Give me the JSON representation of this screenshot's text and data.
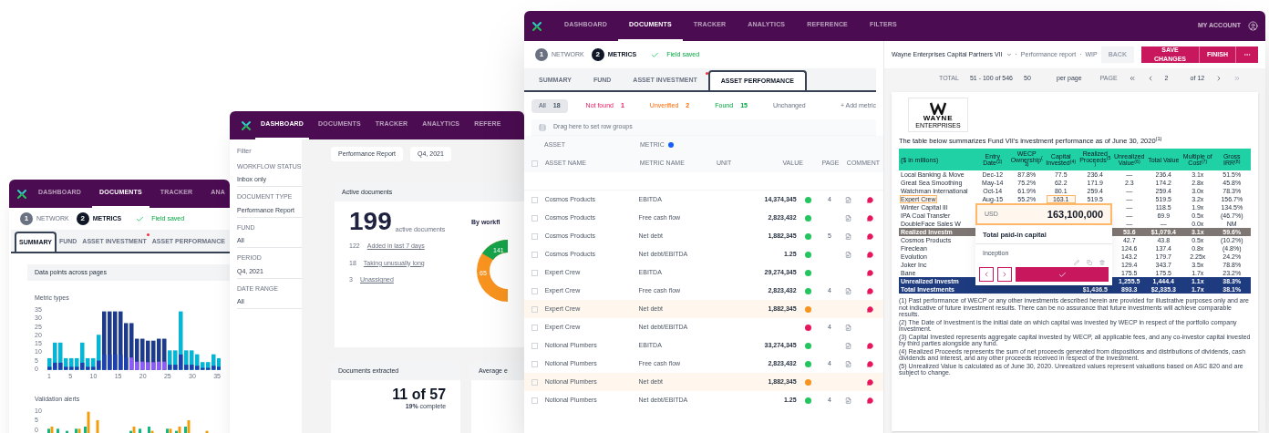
{
  "back_window": {
    "nav": [
      {
        "label": "DASHBOARD",
        "selected": false
      },
      {
        "label": "DOCUMENTS",
        "selected": true
      },
      {
        "label": "TRACKER",
        "selected": false
      },
      {
        "label": "ANA",
        "selected": false
      }
    ],
    "steps": [
      {
        "number": "1",
        "label": "NETWORK",
        "selected": false
      },
      {
        "number": "2",
        "label": "METRICS",
        "selected": true
      }
    ],
    "save_status": "Field saved",
    "tabs": [
      {
        "label": "SUMMARY",
        "selected": true,
        "alert": false
      },
      {
        "label": "FUND",
        "selected": false,
        "alert": false
      },
      {
        "label": "ASSET INVESTMENT",
        "selected": false,
        "alert": true
      },
      {
        "label": "ASSET PERFORMANCE",
        "selected": false,
        "alert": false
      }
    ],
    "card_title": "Data points across pages",
    "charts": [
      {
        "title": "Metric types",
        "y_ticks": [
          "35",
          "30",
          "25",
          "20",
          "15",
          "10",
          "5",
          "0"
        ],
        "x_ticks": [
          "1",
          "5",
          "10",
          "15",
          "20",
          "25",
          "30",
          "35"
        ]
      },
      {
        "title": "Validation alerts",
        "y_ticks": [
          "10",
          "5",
          "0"
        ]
      }
    ]
  },
  "middle_window": {
    "nav": [
      {
        "label": "DASHBOARD",
        "selected": true
      },
      {
        "label": "DOCUMENTS",
        "selected": false
      },
      {
        "label": "TRACKER",
        "selected": false
      },
      {
        "label": "ANALYTICS",
        "selected": false
      },
      {
        "label": "REFERE",
        "selected": false
      }
    ],
    "filters_title": "Filter",
    "filters": [
      {
        "label": "WORKFLOW STATUS",
        "value": "Inbox only"
      },
      {
        "label": "DOCUMENT TYPE",
        "value": "Performance Report"
      },
      {
        "label": "FUND",
        "value": "All"
      },
      {
        "label": "PERIOD",
        "value": "Q4, 2021"
      },
      {
        "label": "DATE RANGE",
        "value": "All"
      }
    ],
    "chips": [
      "Performance Report",
      "Q4, 2021"
    ],
    "active_card": {
      "title": "Active documents",
      "count": "199",
      "count_label": "active documents",
      "items": [
        {
          "count": "122",
          "label": "Added in last 7 days"
        },
        {
          "count": "18",
          "label": "Taking unusually long"
        },
        {
          "count": "3",
          "label": "Unassigned"
        }
      ],
      "side_title": "By workfl",
      "donut_labels": [
        "141",
        "65"
      ]
    },
    "extracted_card": {
      "title": "Documents extracted",
      "value": "11 of 57",
      "note": "**19%** complete"
    },
    "average_card": {
      "title": "Average e"
    }
  },
  "front_window": {
    "nav": [
      {
        "label": "DASHBOARD",
        "selected": false
      },
      {
        "label": "DOCUMENTS",
        "selected": true
      },
      {
        "label": "TRACKER",
        "selected": false
      },
      {
        "label": "ANALYTICS",
        "selected": false
      },
      {
        "label": "REFERENCE",
        "selected": false
      },
      {
        "label": "FILTERS",
        "selected": false
      }
    ],
    "account": "MY ACCOUNT",
    "steps": [
      {
        "number": "1",
        "label": "NETWORK",
        "selected": false
      },
      {
        "number": "2",
        "label": "METRICS",
        "selected": true
      }
    ],
    "save_status": "Field saved",
    "tabs": [
      {
        "label": "SUMMARY",
        "selected": false,
        "alert": false
      },
      {
        "label": "FUND",
        "selected": false,
        "alert": false
      },
      {
        "label": "ASSET INVESTMENT",
        "selected": false,
        "alert": true
      },
      {
        "label": "ASSET PERFORMANCE",
        "selected": true,
        "alert": false
      }
    ],
    "filter_chips": [
      {
        "kind": "all",
        "label": "All",
        "count": "18",
        "selected": true
      },
      {
        "kind": "not_found",
        "label": "Not found",
        "count": "1",
        "selected": false
      },
      {
        "kind": "unverified",
        "label": "Unverified",
        "count": "2",
        "selected": false
      },
      {
        "kind": "found",
        "label": "Found",
        "count": "15",
        "selected": false
      },
      {
        "kind": "unchanged",
        "label": "Unchanged",
        "selected": false
      }
    ],
    "add_button": "+ Add metric",
    "group_hint": "Drag here to set row groups",
    "group_columns": [
      {
        "label": "ASSET",
        "badge": false
      },
      {
        "label": "METRIC",
        "badge": true
      }
    ],
    "select_all_checked": false,
    "columns": [
      "ASSET NAME",
      "METRIC NAME",
      "UNIT",
      "VALUE",
      "PAGE",
      "COMMENT"
    ],
    "rows": [
      {
        "asset": "Cosmos Products",
        "metric": "EBITDA",
        "value": "14,374,345",
        "color": "#22c55e",
        "highlighted": false,
        "page": "4",
        "linked": true,
        "comment": true,
        "checked": false
      },
      {
        "asset": "Cosmos Products",
        "metric": "Free cash flow",
        "value": "2,823,432",
        "color": "#22c55e",
        "highlighted": false,
        "linked": true,
        "comment": true,
        "checked": false
      },
      {
        "asset": "Cosmos Products",
        "metric": "Net debt",
        "value": "1,882,345",
        "color": "#22c55e",
        "highlighted": false,
        "page": "5",
        "linked": true,
        "comment": true,
        "checked": false
      },
      {
        "asset": "Cosmos Products",
        "metric": "Net debt/EBITDA",
        "value": "1.25",
        "color": "#22c55e",
        "highlighted": false,
        "linked": true,
        "comment": true,
        "checked": false
      },
      {
        "asset": "Expert Crew",
        "metric": "EBITDA",
        "value": "29,274,345",
        "color": "#22c55e",
        "highlighted": false,
        "linked": false,
        "comment": true,
        "checked": false
      },
      {
        "asset": "Expert Crew",
        "metric": "Free cash flow",
        "value": "2,823,432",
        "color": "#22c55e",
        "highlighted": false,
        "page": "4",
        "linked": true,
        "comment": true,
        "checked": false
      },
      {
        "asset": "Expert Crew",
        "metric": "Net debt",
        "value": "1,882,345",
        "color": "#f7931e",
        "highlighted": true,
        "linked": false,
        "comment": true,
        "checked": false
      },
      {
        "asset": "Expert Crew",
        "metric": "Net debt/EBITDA",
        "color": "#e8175d",
        "highlighted": false,
        "page": "4",
        "linked": true,
        "comment": false,
        "checked": false
      },
      {
        "asset": "Notional Plumbers",
        "metric": "EBITDA",
        "value": "33,274,345",
        "color": "#22c55e",
        "highlighted": false,
        "linked": true,
        "comment": true,
        "checked": false
      },
      {
        "asset": "Notional Plumbers",
        "metric": "Free cash flow",
        "value": "2,823,432",
        "color": "#22c55e",
        "highlighted": false,
        "page": "4",
        "linked": true,
        "comment": true,
        "checked": false
      },
      {
        "asset": "Notional Plumbers",
        "metric": "Net debt",
        "value": "1,882,345",
        "color": "#f7931e",
        "highlighted": true,
        "linked": false,
        "comment": true,
        "checked": false
      },
      {
        "asset": "Notional Plumbers",
        "metric": "Net debt/EBITDA",
        "value": "1.25",
        "color": "#22c55e",
        "highlighted": false,
        "page": "4",
        "linked": true,
        "comment": true,
        "checked": false
      }
    ],
    "breadcrumb": {
      "fund": "Wayne Enterprises Capital Partners VII",
      "separator": "·",
      "items": [
        "Performance report",
        "WIP"
      ]
    },
    "actions": [
      {
        "kind": "back",
        "label": "BACK",
        "disabled": true
      },
      {
        "kind": "save",
        "label": "SAVE CHANGES",
        "disabled": false
      },
      {
        "kind": "finish",
        "label": "FINISH",
        "disabled": false
      },
      {
        "kind": "more",
        "disabled": false
      }
    ],
    "pager": {
      "total_label": "TOTAL",
      "range": "51 - 100 of 546",
      "per_page": "50",
      "per_page_label": "per page",
      "page_label": "PAGE",
      "page": "2",
      "page_count": "of 12"
    },
    "document": {
      "logo": "WAYNE",
      "logo_sub": "ENTERPRISES",
      "heading": "The table below summarizes Fund VII's investment performance as of June 30, 2020$^{(1)}$",
      "columns": [
        "($ in millions)",
        "Entry Date$^{(2)}$",
        "WECP Ownership$^{(3)}$",
        "Capital Invested$^{(4)}$",
        "Realized Proceeds$^{(5)}$",
        "Unrealized Value$^{(6)}$",
        "Total Value",
        "Multiple of Cost$^{(7)}$",
        "Gross IRR$^{(8)}$"
      ],
      "rows": [
        {
          "kind": "row",
          "cells": [
            "Local Banking & Move",
            "Dec-12",
            "87.8%",
            "77.5",
            "236.4",
            "—",
            "236.4",
            "3.1x",
            "51.5%"
          ],
          "highlight": false
        },
        {
          "kind": "row",
          "cells": [
            "Great Sea Smoothing",
            "May-14",
            "75.2%",
            "62.2",
            "171.9",
            "2.3",
            "174.2",
            "2.8x",
            "45.8%"
          ],
          "highlight": false
        },
        {
          "kind": "row",
          "cells": [
            "Watchman International",
            "Oct-14",
            "61.9%",
            "80.1",
            "259.4",
            "—",
            "259.4",
            "3.0x",
            "78.3%"
          ],
          "highlight": false
        },
        {
          "kind": "row",
          "cells": [
            "Expert Crew",
            "Aug-15",
            "55.2%",
            "163.1",
            "519.5",
            "—",
            "519.5",
            "3.2x",
            "156.7%"
          ],
          "highlight": true
        },
        {
          "kind": "row",
          "cells": [
            "Winter Capital III",
            "",
            "",
            "",
            "",
            "—",
            "118.5",
            "1.9x",
            "134.5%"
          ],
          "highlight": false
        },
        {
          "kind": "row",
          "cells": [
            "IPA Coal Transfer",
            "",
            "",
            "",
            "",
            "—",
            "69.9",
            "0.5x",
            "(46.7%)"
          ],
          "highlight": false
        },
        {
          "kind": "row",
          "cells": [
            "DoubleFace Sales W",
            "",
            "",
            "",
            "",
            "—",
            "—",
            "0.0x",
            "NM"
          ],
          "highlight": false
        },
        {
          "kind": "subtotal",
          "cells": [
            "Realized Investm",
            "",
            "",
            "",
            "",
            "53.6",
            "$1,079.4",
            "3.1x",
            "59.6%"
          ],
          "highlight": false
        },
        {
          "kind": "row",
          "cells": [
            "Cosmos Products",
            "",
            "",
            "",
            "",
            "42.7",
            "43.8",
            "0.5x",
            "(10.2%)"
          ],
          "highlight": false
        },
        {
          "kind": "row",
          "cells": [
            "Fireclean",
            "",
            "",
            "",
            "",
            "124.6",
            "137.4",
            "0.8x",
            "(4.8%)"
          ],
          "highlight": false
        },
        {
          "kind": "row",
          "cells": [
            "Evolution",
            "",
            "",
            "",
            "",
            "143.2",
            "179.7",
            "2.25x",
            "24.2%"
          ],
          "highlight": false
        },
        {
          "kind": "row",
          "cells": [
            "Joker Inc",
            "",
            "",
            "",
            "",
            "129.4",
            "343.7",
            "3.5x",
            "78.8%"
          ],
          "highlight": false
        },
        {
          "kind": "row",
          "cells": [
            "Bane",
            "",
            "",
            "",
            "",
            "175.5",
            "175.5",
            "1.7x",
            "23.2%"
          ],
          "highlight": false
        },
        {
          "kind": "total",
          "cells": [
            "Unrealized Investm",
            "",
            "",
            "",
            "",
            "1,255.5",
            "1,444.4",
            "1.1x",
            "38.3%"
          ],
          "highlight": false
        },
        {
          "kind": "total",
          "cells": [
            "Total Investments",
            "",
            "",
            "",
            "$1,436.5",
            "893.3",
            "$2,335.3",
            "1.7x",
            "38.1%"
          ],
          "highlight": false
        }
      ],
      "popup": {
        "currency": "USD",
        "value": "163,100,000",
        "label": "Total paid-in capital",
        "period": "Inception"
      },
      "footnotes": [
        "(1) Past performance of WECP or any other investments described herein are provided for illustrative purposes only and are not indicative of future investment results. There can be no assurance that future investments will achieve comparable results.",
        "(2) The Date of Investment is the initial date on which capital was invested by WECP in respect of the portfolio company investment.",
        "(3) Capital Invested represents aggregate capital invested by WECP, all applicable fees, and any co-investor capital invested by third parties alongside any fund.",
        "(4) Realized Proceeds represents the sum of net proceeds generated from dispositions and distributions of dividends, cash dividends and interest, and any other proceeds received in respect of the investment.",
        "(5) Unrealized Value is calculated as of June 30, 2020. Unrealized values represent valuations based on ASC 820 and are subject to change."
      ]
    }
  }
}
